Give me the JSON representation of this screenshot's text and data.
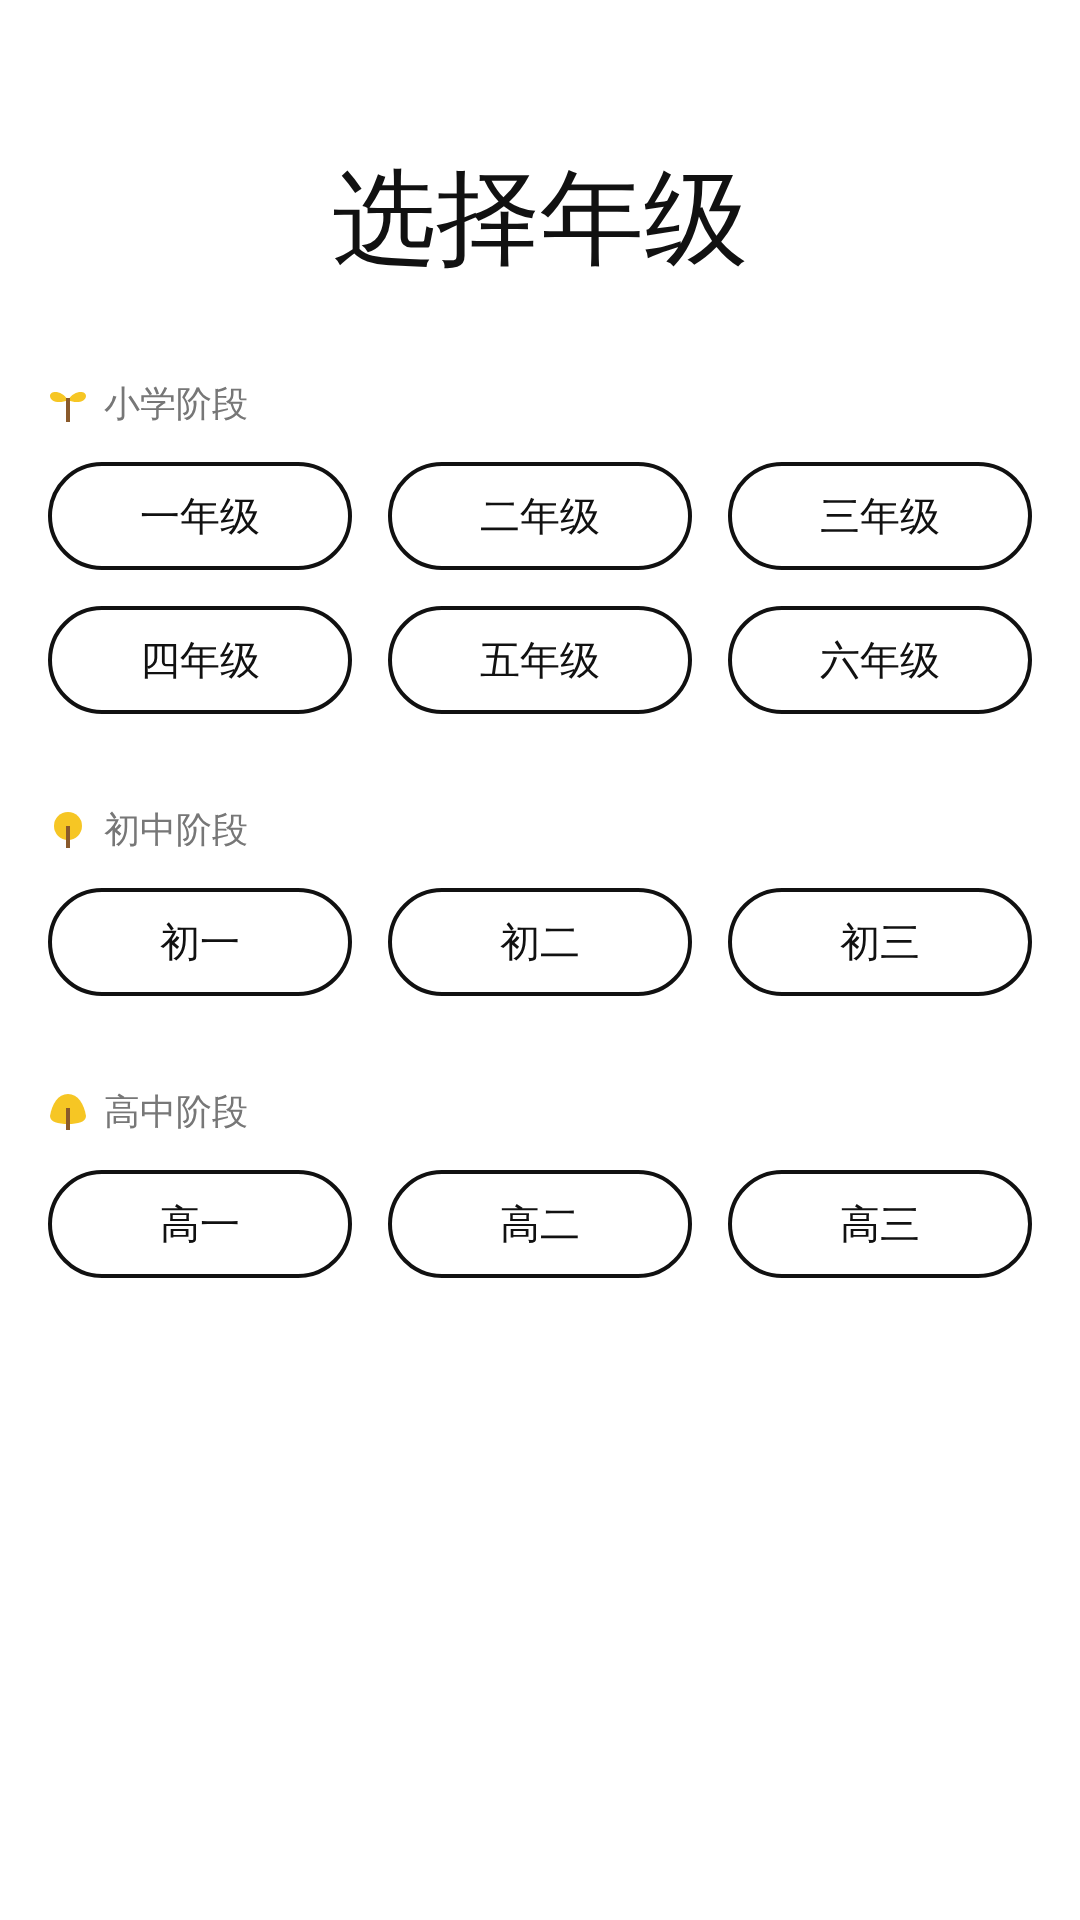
{
  "title": "选择年级",
  "sections": [
    {
      "label": "小学阶段",
      "kind": "sprout",
      "grades": [
        "一年级",
        "二年级",
        "三年级",
        "四年级",
        "五年级",
        "六年级"
      ]
    },
    {
      "label": "初中阶段",
      "kind": "sapling",
      "grades": [
        "初一",
        "初二",
        "初三"
      ]
    },
    {
      "label": "高中阶段",
      "kind": "tree",
      "grades": [
        "高一",
        "高二",
        "高三"
      ]
    }
  ]
}
